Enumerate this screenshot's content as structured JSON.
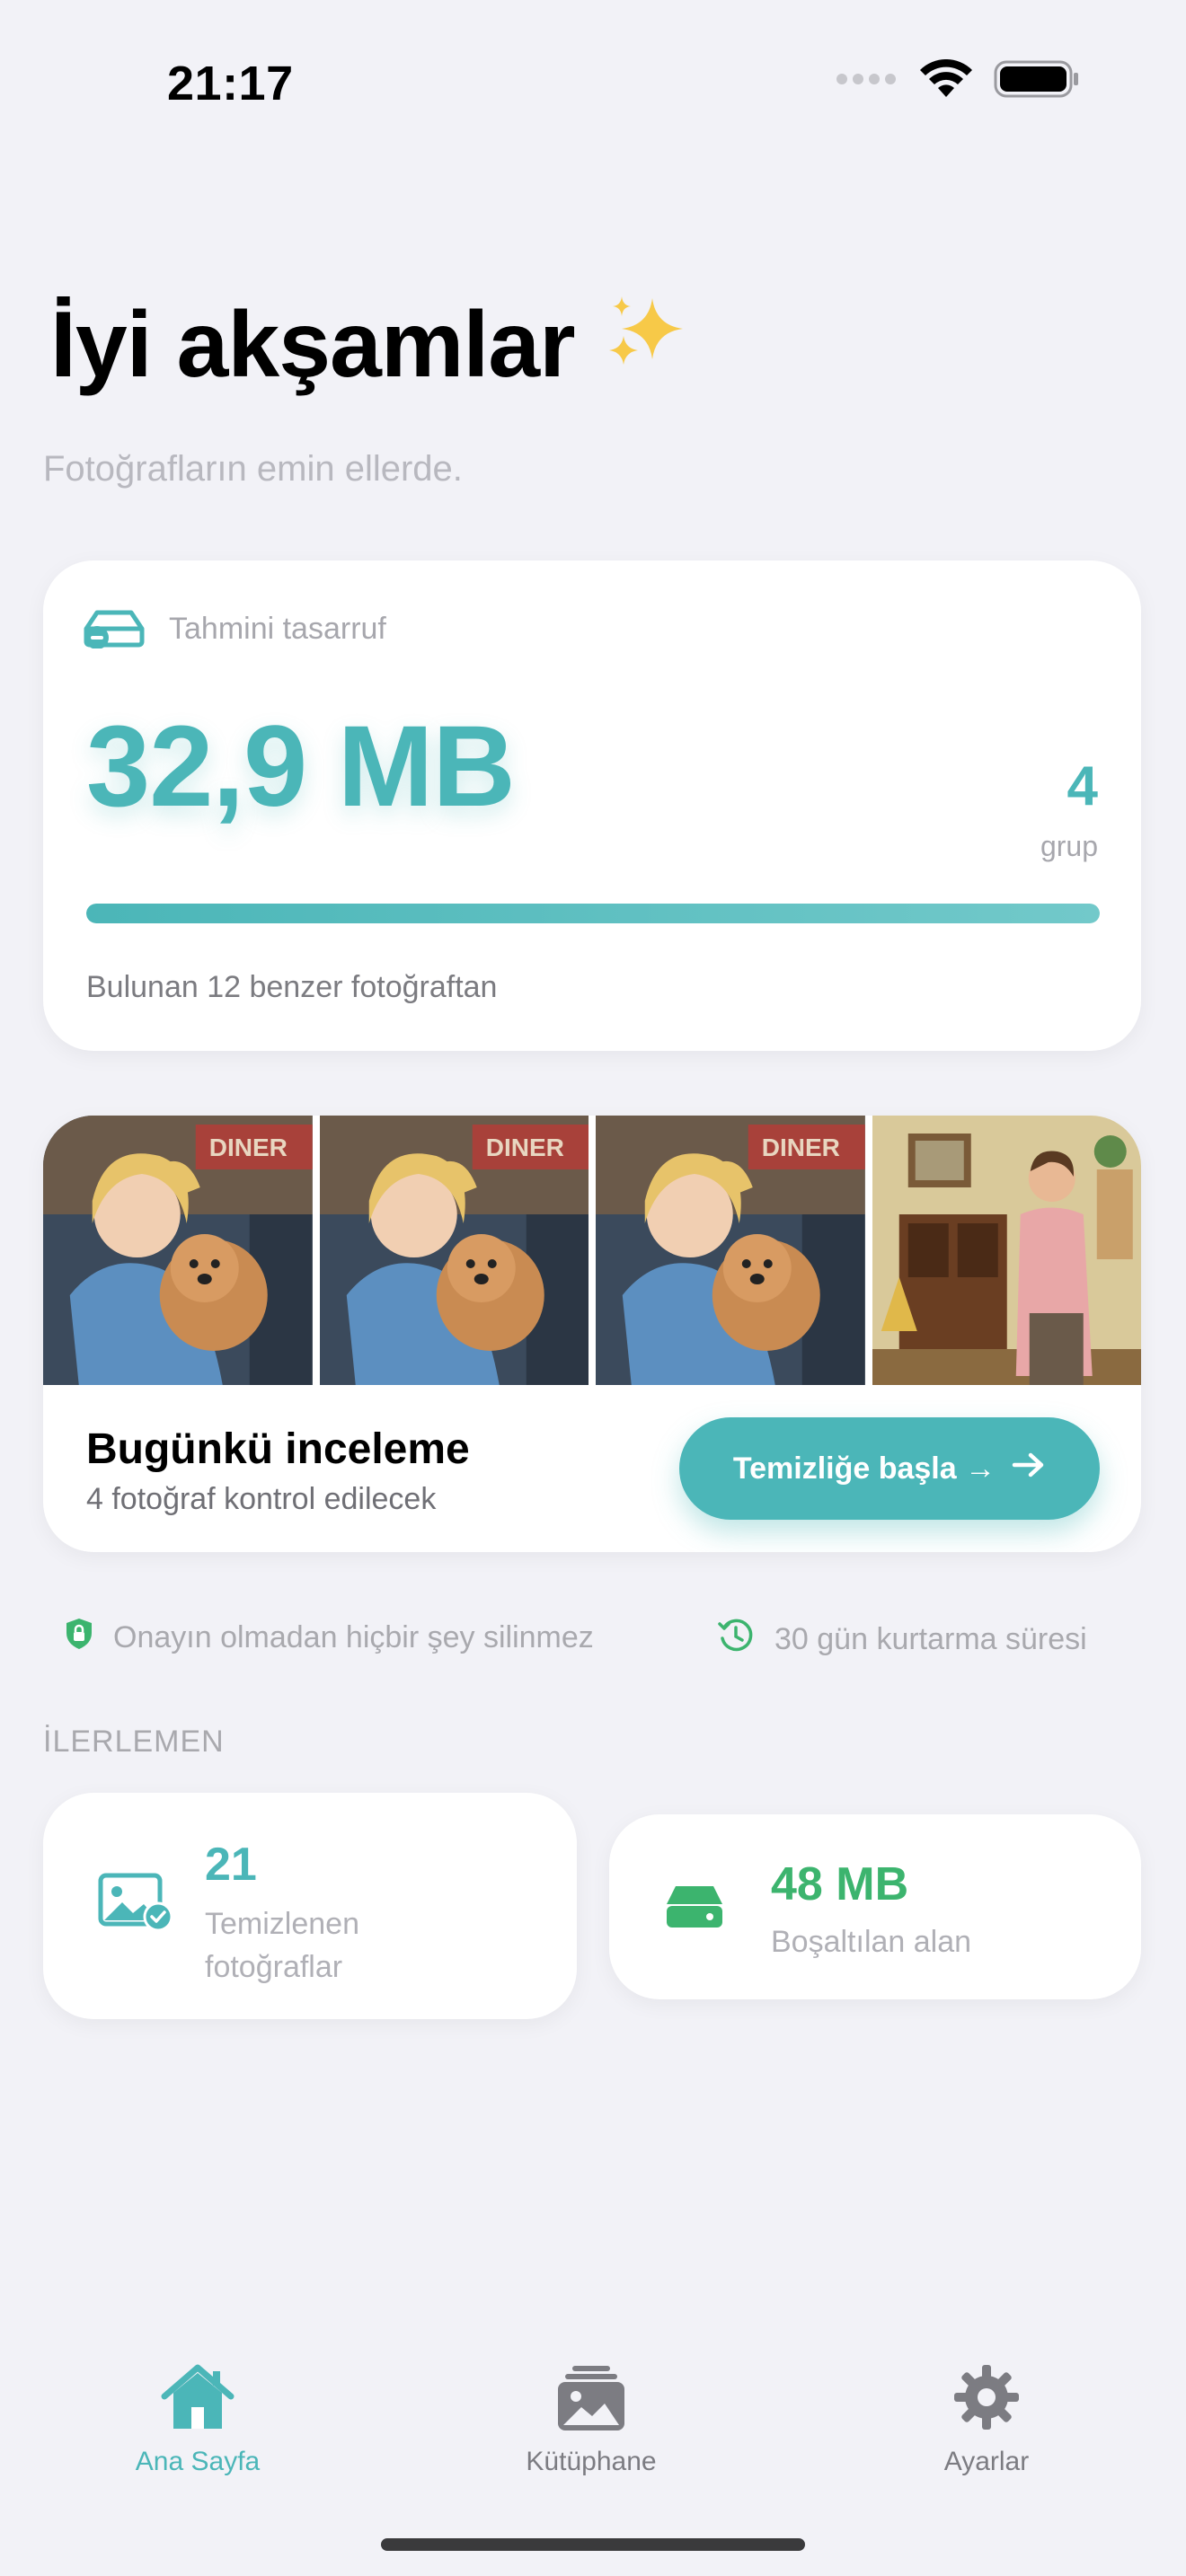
{
  "status_bar": {
    "time": "21:17"
  },
  "header": {
    "greeting": "İyi akşamlar",
    "greeting_emoji": "sparkles-icon",
    "subtitle": "Fotoğrafların emin ellerde."
  },
  "savings": {
    "label": "Tahmini tasarruf",
    "amount": "32,9 MB",
    "group_count": "4",
    "group_label": "grup",
    "progress_fraction": 1.0,
    "footnote": "Bulunan 12 benzer fotoğraftan"
  },
  "review": {
    "thumbnails": [
      "girl-with-puppy-photo",
      "girl-with-puppy-photo",
      "girl-with-puppy-photo",
      "man-in-room-photo"
    ],
    "title": "Bugünkü inceleme",
    "subtitle": "4 fotoğraf kontrol edilecek",
    "button_label": "Temizliğe başla →"
  },
  "info": {
    "safety_text": "Onayın olmadan hiçbir şey silinmez",
    "recovery_text": "30 gün kurtarma süresi"
  },
  "progress": {
    "section_label": "İLERLEMEN",
    "cleaned": {
      "value": "21",
      "label_line1": "Temizlenen",
      "label_line2": "fotoğraflar"
    },
    "freed": {
      "value": "48 MB",
      "label": "Boşaltılan alan"
    }
  },
  "tabbar": {
    "items": [
      {
        "label": "Ana Sayfa",
        "icon": "house-icon",
        "active": true
      },
      {
        "label": "Kütüphane",
        "icon": "photo-stack-icon",
        "active": false
      },
      {
        "label": "Ayarlar",
        "icon": "gear-icon",
        "active": false
      }
    ]
  },
  "colors": {
    "accent": "#4bb6b8",
    "green": "#3cb46e",
    "background": "#f2f2f7"
  }
}
